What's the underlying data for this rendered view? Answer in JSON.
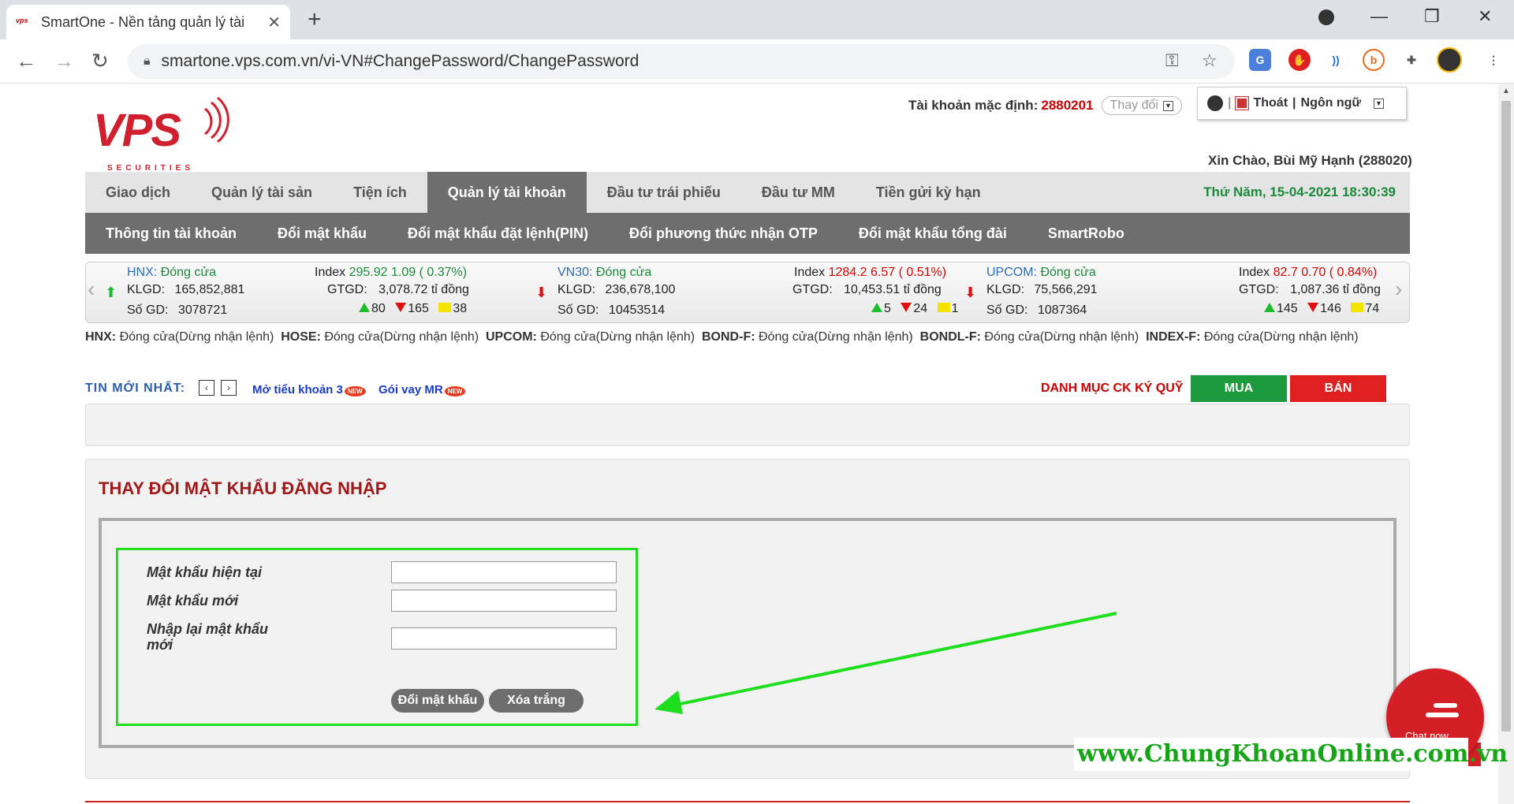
{
  "browser": {
    "tab_title": "SmartOne - Nền tảng quản lý tài",
    "favicon_text": "vps",
    "url": "smartone.vps.com.vn/vi-VN#ChangePassword/ChangePassword"
  },
  "header": {
    "logo_text": "VPS",
    "logo_sub": "SECURITIES",
    "account_label": "Tài khoản mặc định:",
    "account_number": "2880201",
    "change_label": "Thay đổi",
    "exit_label": "Thoát",
    "language_label": "Ngôn ngữ",
    "greeting": "Xin Chào, Bùi Mỹ Hạnh (288020)"
  },
  "main_nav": {
    "items": [
      "Giao dịch",
      "Quản lý tài sản",
      "Tiện ích",
      "Quản lý tài khoản",
      "Đầu tư trái phiếu",
      "Đầu tư MM",
      "Tiền gửi kỳ hạn"
    ],
    "active_index": 3,
    "datetime": "Thứ Năm, 15-04-2021 18:30:39"
  },
  "sub_nav": {
    "items": [
      "Thông tin tài khoản",
      "Đổi mật khẩu",
      "Đổi mật khẩu đặt lệnh(PIN)",
      "Đổi phương thức nhận OTP",
      "Đổi mật khẩu tổng đài",
      "SmartRobo"
    ]
  },
  "ticker": {
    "markets": [
      {
        "name": "HNX:",
        "state": "Đóng cửa",
        "index_label": "Index",
        "index": "295.92",
        "change": "1.09",
        "pct": "( 0.37%)",
        "direction": "up",
        "klgd_label": "KLGD:",
        "klgd": "165,852,881",
        "gtgd_label": "GTGD:",
        "gtgd": "3,078.72 tỉ đồng",
        "sogd_label": "Số GD:",
        "sogd": "3078721",
        "up": "80",
        "down": "165",
        "flat": "38"
      },
      {
        "name": "VN30:",
        "state": "Đóng cửa",
        "index_label": "Index",
        "index": "1284.2",
        "change": "6.57",
        "pct": "( 0.51%)",
        "direction": "down",
        "klgd_label": "KLGD:",
        "klgd": "236,678,100",
        "gtgd_label": "GTGD:",
        "gtgd": "10,453.51 tỉ đồng",
        "sogd_label": "Số GD:",
        "sogd": "10453514",
        "up": "5",
        "down": "24",
        "flat": "1"
      },
      {
        "name": "UPCOM:",
        "state": "Đóng cửa",
        "index_label": "Index",
        "index": "82.7",
        "change": "0.70",
        "pct": "( 0.84%)",
        "direction": "down",
        "klgd_label": "KLGD:",
        "klgd": "75,566,291",
        "gtgd_label": "GTGD:",
        "gtgd": "1,087.36 tỉ đồng",
        "sogd_label": "Số GD:",
        "sogd": "1087364",
        "up": "145",
        "down": "146",
        "flat": "74"
      }
    ]
  },
  "status_line": {
    "items": [
      {
        "market": "HNX:",
        "status": "Đóng cửa(Dừng nhận lệnh)"
      },
      {
        "market": "HOSE:",
        "status": "Đóng cửa(Dừng nhận lệnh)"
      },
      {
        "market": "UPCOM:",
        "status": "Đóng cửa(Dừng nhận lệnh)"
      },
      {
        "market": "BOND-F:",
        "status": "Đóng cửa(Dừng nhận lệnh)"
      },
      {
        "market": "BONDL-F:",
        "status": "Đóng cửa(Dừng nhận lệnh)"
      },
      {
        "market": "INDEX-F:",
        "status": "Đóng cửa(Dừng nhận lệnh)"
      }
    ]
  },
  "news": {
    "label": "TIN MỚI NHẤT:",
    "prev": "‹",
    "next": "›",
    "links": [
      "Mở tiểu khoản 3",
      "Gói vay MR"
    ],
    "new_badge": "NEW",
    "danh_muc": "DANH MỤC CK KÝ QUỸ",
    "buy": "MUA",
    "sell": "BÁN"
  },
  "form": {
    "title": "THAY ĐỔI MẬT KHẨU ĐĂNG NHẬP",
    "current_label": "Mật khẩu hiện tại",
    "new_label": "Mật khẩu mới",
    "confirm_label_1": "Nhập lại mật khẩu",
    "confirm_label_2": "mới",
    "current_value": "",
    "new_value": "",
    "confirm_value": "",
    "submit": "Đổi mật khẩu",
    "clear": "Xóa trắng"
  },
  "chat": {
    "label": "Chat now"
  },
  "watermark": "www.ChungKhoanOnline.com.vn",
  "colors": {
    "brand_red": "#d01f2e",
    "nav_grey": "#6e6e6e",
    "buy_green": "#1d9a3d",
    "sell_red": "#e02020",
    "highlight_green": "#1ede1e"
  }
}
